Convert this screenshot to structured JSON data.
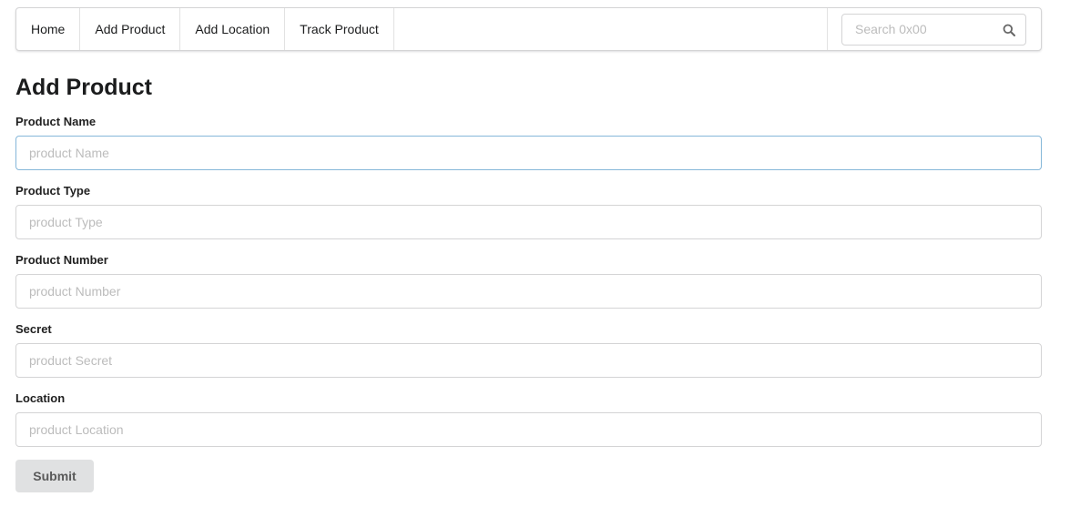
{
  "nav": {
    "items": [
      {
        "label": "Home"
      },
      {
        "label": "Add Product"
      },
      {
        "label": "Add Location"
      },
      {
        "label": "Track Product"
      }
    ],
    "search_placeholder": "Search 0x00",
    "search_icon": "search-icon"
  },
  "page": {
    "title": "Add Product"
  },
  "form": {
    "fields": [
      {
        "label": "Product Name",
        "placeholder": "product Name",
        "value": ""
      },
      {
        "label": "Product Type",
        "placeholder": "product Type",
        "value": ""
      },
      {
        "label": "Product Number",
        "placeholder": "product Number",
        "value": ""
      },
      {
        "label": "Secret",
        "placeholder": "product Secret",
        "value": ""
      },
      {
        "label": "Location",
        "placeholder": "product Location",
        "value": ""
      }
    ],
    "submit_label": "Submit"
  },
  "colors": {
    "focus_border": "#85b7d9",
    "button_bg": "#e0e1e2"
  }
}
